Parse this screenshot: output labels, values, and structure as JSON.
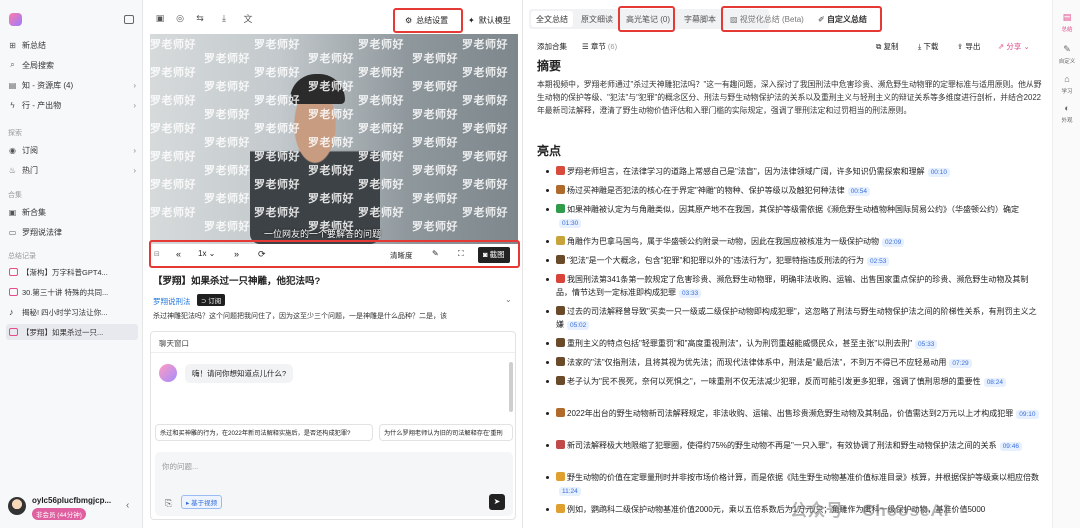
{
  "sidebar": {
    "nav": [
      {
        "icon": "plus-icon",
        "label": "新总结"
      },
      {
        "icon": "search-icon",
        "label": "全局搜索"
      },
      {
        "icon": "book-icon",
        "label": "知 - 资源库 (4)"
      },
      {
        "icon": "bolt-icon",
        "label": "行 - 产出物"
      }
    ],
    "explore_title": "探索",
    "explore": [
      {
        "icon": "rss-icon",
        "label": "订阅"
      },
      {
        "icon": "fire-icon",
        "label": "热门"
      }
    ],
    "collection_title": "合集",
    "collection": [
      {
        "icon": "folder-plus-icon",
        "label": "新合集"
      },
      {
        "icon": "folder-icon",
        "label": "罗翔说法律"
      }
    ],
    "history_title": "总结记录",
    "history": [
      {
        "label": "【渐构】万字科普GPT4..."
      },
      {
        "label": "30.第三十讲 特殊的共同..."
      },
      {
        "label": "揭秘! 四小时学习法让你..."
      },
      {
        "label": "【罗翔】如果杀过一只..."
      }
    ],
    "user": {
      "name": "oylc56plucfbmgjcp...",
      "badge": "非会员 (44分钟)"
    }
  },
  "player": {
    "top_settings": "总结设置",
    "top_model": "默认模型",
    "watermark": "罗老师好",
    "subtitle": "一位网友的一个要解答的问题",
    "speed": "1x",
    "quality": "清晰度",
    "screenshot": "截图",
    "title": "【罗翔】如果杀过一只神雕，他犯法吗?",
    "channel": "罗翔说刑法",
    "subscribe": "订阅",
    "desc": "杀过神雕犯法吗？这个问题把我问住了，因为这至少三个问题，一是神雕是什么品种？二是，该"
  },
  "chat": {
    "title": "聊天窗口",
    "greeting": "嗨！请问你想知道点儿什么?",
    "suggestions": [
      "杀过和买神雕的行为，在2022年新司法解释实施后，是否还构成犯罪?",
      "为什么罗翔老师认为旧的司法解释存在'重刑"
    ],
    "placeholder": "你的问题...",
    "video_chip": "基于视频"
  },
  "tabs": [
    "全文总结",
    "原文细读",
    "高光笔记 (0)",
    "字幕脚本",
    "视觉化总结 (Beta)",
    "自定义总结"
  ],
  "actions": {
    "add": "添加合集",
    "chapter": "章节",
    "chapter_count": "(6)",
    "copy": "复制",
    "download": "下载",
    "export": "导出",
    "share": "分享"
  },
  "summary": {
    "h1": "摘要",
    "p": "本期视频中，罗翔老师通过\"杀过天神雕犯法吗？\"这一有趣问题，深入探讨了我国刑法中危害珍贵、濒危野生动物罪的定罪标准与适用原则。他从野生动物的保护等级、\"犯法\"与\"犯罪\"的概念区分、刑法与野生动物保护法的关系以及重刑主义与轻刑主义的辩证关系等多维度进行剖析，并结合2022年最新司法解释，澄清了野生动物价值评估和入罪门槛的实际规定，强调了罪刑法定和过罚相当的刑法原则。",
    "h2": "亮点",
    "items": [
      {
        "c": "#d84a3a",
        "t": "罗翔老师坦言，在法律学习的道路上常感自己是\"法盲\"，因为法律领域广阔，许多知识仍需探索和理解",
        "ts": "00:10"
      },
      {
        "c": "#b06a2c",
        "t": "杨过买神雕是否犯法的核心在于界定\"神雕\"的物种、保护等级以及触犯何种法律",
        "ts": "00:54"
      },
      {
        "c": "#2e9c4a",
        "t": "如果神雕被认定为与角雕类似，因其原产地不在我国，其保护等级需依据《濒危野生动植物种国际贸易公约》（华盛顿公约）确定",
        "ts": "01:30"
      },
      {
        "c": "#c7a43a",
        "t": "角雕作为巴拿马国鸟，属于华盛顿公约附录一动物，因此在我国应被核准为一级保护动物",
        "ts": "02:09"
      },
      {
        "c": "#6b4a2a",
        "t": "\"犯法\"是一个大概念，包含\"犯罪\"和犯罪以外的\"违法行为\"，犯罪特指违反刑法的行为",
        "ts": "02:53"
      },
      {
        "c": "#d8443a",
        "t": "我国刑法第341条第一款规定了危害珍贵、濒危野生动物罪，明确非法收购、运输、出售国家重点保护的珍贵、濒危野生动物及其制品，情节达到一定标准即构成犯罪",
        "ts": "03:33"
      },
      {
        "c": "#6b4a2a",
        "t": "过去的司法解释曾导致\"买卖一只一级或二级保护动物即构成犯罪\"，这忽略了刑法与野生动物保护法之间的阶梯性关系，有刑罚主义之嫌",
        "ts": "05:02"
      },
      {
        "c": "#6b4a2a",
        "t": "重刑主义的特点包括\"轻罪重罚\"和\"高度重视刑法\"，认为刑罚重越能威慑民众，甚至主张\"以刑去刑\"",
        "ts": "05:33"
      },
      {
        "c": "#6b4a2a",
        "t": "法家的\"法\"仅指刑法，且将其视为优先法；而现代法律体系中，刑法是\"最后法\"，不到万不得已不应轻易动用",
        "ts": "07:29"
      },
      {
        "c": "#6b4a2a",
        "t": "老子认为\"民不畏死，奈何以死惧之\"，一味重刑不仅无法减少犯罪，反而可能引发更多犯罪，强调了慎刑思想的重要性",
        "ts": "08:24"
      },
      {
        "c": "#b06a2c",
        "t": "2022年出台的野生动物新司法解释规定，非法收购、运输、出售珍贵濒危野生动物及其制品，价值需达到2万元以上才构成犯罪",
        "ts": "09:10"
      },
      {
        "c": "#c04a4a",
        "t": "新司法解释极大地限缩了犯罪圈，使得约75%的野生动物不再是\"一只入罪\"，有效协调了刑法和野生动物保护法之间的关系",
        "ts": "09:46"
      },
      {
        "c": "#e0a030",
        "t": "野生动物的价值在定罪量刑时并非按市场价格计算，而是依据《陆生野生动物基准价值标准目录》核算，并根据保护等级乘以相应倍数",
        "ts": "11:24"
      },
      {
        "c": "#e0a030",
        "t": "例如，鹦鹉科二级保护动物基准价值2000元，乘以五倍系数后为1万元/只；角雕作为鹰科一级保护动物，基准价值5000",
        "ts": ""
      }
    ]
  },
  "rail": [
    {
      "icon": "document-icon",
      "label": "总结"
    },
    {
      "icon": "pen-icon",
      "label": "自定义"
    },
    {
      "icon": "cap-icon",
      "label": "学习"
    },
    {
      "icon": "palette-icon",
      "label": "外观"
    }
  ],
  "watermark_text": "公众号 · ChooseAI"
}
